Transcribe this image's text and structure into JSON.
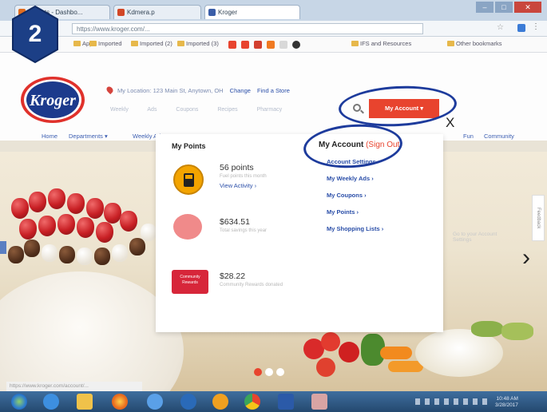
{
  "step_badge": {
    "number": "2"
  },
  "browser": {
    "tabs": [
      {
        "label": "MyLists - Dashbo...",
        "icon_color": "#e06c1f"
      },
      {
        "label": "Kdmera.p",
        "icon_color": "#d24726"
      },
      {
        "label": "Kroger",
        "icon_color": "#3b5ea8"
      }
    ],
    "address": "https://www.kroger.com/...",
    "bookmarks": [
      "Apps",
      "Imported",
      "Imported (2)",
      "Imported (3)",
      "IFS and Resources",
      "Other bookmarks"
    ]
  },
  "header": {
    "logo_text": "Kroger",
    "store_label": "My Location: 123 Main St, Anytown, OH",
    "change_label": "Change",
    "find_store_label": "Find a Store",
    "subnav": "Weekly Ads  Coupons  Recipes  Pharmacy",
    "account_button": "My Account ▾",
    "close_mark": "X",
    "nav": [
      "Home",
      "Departments ▾",
      "Weekly Ads",
      "Fun",
      "Community"
    ]
  },
  "panel": {
    "points_title": "My Points",
    "points_value": "56 points",
    "points_sub": "Fuel points this month",
    "points_link": "View Activity ›",
    "savings_value": "$634.51",
    "savings_sub": "Total savings this year",
    "community_value": "$28.22",
    "community_sub": "Community Rewards donated",
    "community_badge": "Community Rewards",
    "account_title": "My Account",
    "sign_out": "(Sign Out)",
    "account_links": [
      "Account Settings ›",
      "My Weekly Ads ›",
      "My Coupons ›",
      "My Points ›",
      "My Shopping Lists ›"
    ],
    "promo_text": "Go to your Account Settings"
  },
  "hero": {
    "feedback_label": "Feedback",
    "next_arrow": "›",
    "dots": [
      "#e8442e",
      "#ffffff",
      "#ffffff"
    ]
  },
  "status_url": "https://www.kroger.com/account/...",
  "taskbar": {
    "tray_time": "10:48 AM",
    "tray_date": "3/28/2017"
  },
  "colors": {
    "accent": "#e8442e",
    "annotation": "#1d3b9c",
    "link": "#2a4ea8",
    "kroger_blue": "#1c3a8c"
  }
}
